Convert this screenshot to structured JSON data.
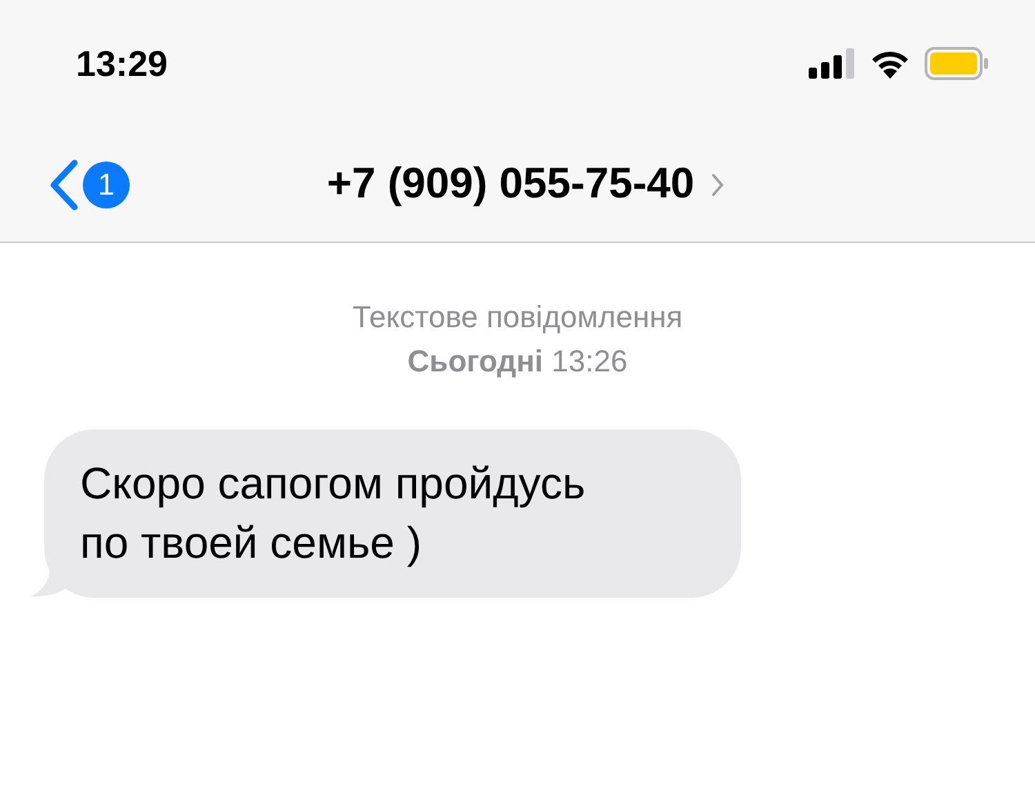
{
  "status_bar": {
    "time": "13:29"
  },
  "header": {
    "back_badge": "1",
    "title": "+7 (909) 055-75-40"
  },
  "thread": {
    "kind_label": "Текстове повідомлення",
    "timestamp": "**Сьогодні** 13:26"
  },
  "messages": [
    {
      "kind": "incoming",
      "text": "Скоро сапогом пройдусь\nпо твоей семье )"
    }
  ]
}
